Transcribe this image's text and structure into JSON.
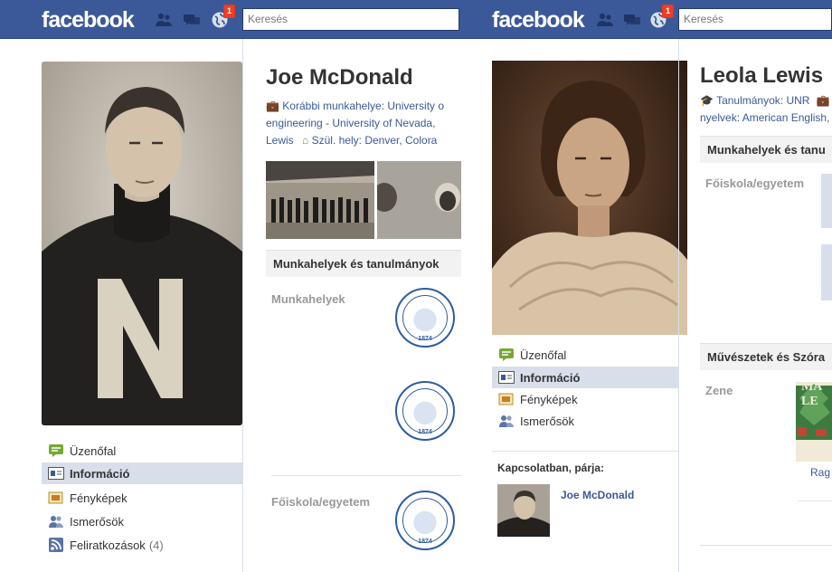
{
  "left_profile": {
    "header": {
      "logo": "facebook",
      "search_placeholder": "Keresés",
      "notification_count": "1"
    },
    "name": "Joe McDonald",
    "info_line1": "Korábbi munkahelye: University o",
    "info_line2": "engineering - University of Nevada,",
    "info_line3_a": "Lewis",
    "info_line3_b": "Szül. hely: Denver, Colora",
    "nav": [
      {
        "label": "Üzenőfal"
      },
      {
        "label": "Információ"
      },
      {
        "label": "Fényképek"
      },
      {
        "label": "Ismerősök"
      },
      {
        "label": "Feliratkozások",
        "count": "(4)"
      }
    ],
    "section_title": "Munkahelyek és tanulmányok",
    "work_label": "Munkahelyek",
    "school_label": "Főiskola/egyetem",
    "seal_year": "1874",
    "seal_ring_text": "UNIVERSITY OF NEVADA"
  },
  "right_profile": {
    "header": {
      "logo": "facebook",
      "search_placeholder": "Keresés",
      "notification_count": "1"
    },
    "name": "Leola Lewis",
    "info_line1_a": "Tanulmányok: UNR",
    "info_line2": "nyelvek: American English,",
    "nav": [
      {
        "label": "Üzenőfal"
      },
      {
        "label": "Információ"
      },
      {
        "label": "Fényképek"
      },
      {
        "label": "Ismerősök"
      }
    ],
    "section_title": "Munkahelyek és tanu",
    "school_label": "Főiskola/egyetem",
    "arts_title": "Művészetek és Szóra",
    "music_label": "Zene",
    "music_item_text": "MA LE",
    "music_caption": "Rag",
    "relationship_label": "Kapcsolatban, párja:",
    "partner_name": "Joe McDonald"
  },
  "colors": {
    "brand": "#3b5998",
    "nav_active": "#d8dfea",
    "section_bg": "#f2f2f2",
    "badge": "#f03d25"
  }
}
